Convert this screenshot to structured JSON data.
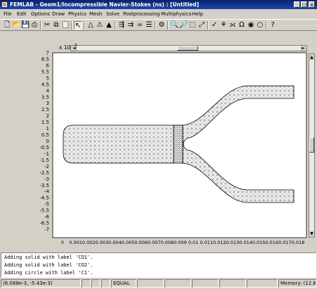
{
  "window": {
    "title": "FEMLAB - Geom1/Incompressible Navier-Stokes (ns) : [Untitled]",
    "min": "_",
    "max": "□",
    "close": "×"
  },
  "menu": [
    "File",
    "Edit",
    "Options",
    "Draw",
    "Physics",
    "Mesh",
    "Solve",
    "Postprocessing",
    "Multiphysics",
    "Help"
  ],
  "toolbar": [
    {
      "name": "new-icon",
      "glyph": "🗋"
    },
    {
      "name": "open-icon",
      "glyph": "📂"
    },
    {
      "name": "save-icon",
      "glyph": "💾"
    },
    {
      "name": "print-icon",
      "glyph": "⎙"
    },
    {
      "name": "cut-icon",
      "glyph": "✂"
    },
    {
      "name": "copy-icon",
      "glyph": "⧉"
    },
    {
      "name": "paste-icon",
      "glyph": "📋"
    },
    {
      "name": "pointer-icon",
      "glyph": "↖"
    },
    {
      "name": "triangle-icon",
      "glyph": "△"
    },
    {
      "name": "tri-refine-icon",
      "glyph": "⚠"
    },
    {
      "name": "mesh-icon",
      "glyph": "▲"
    },
    {
      "name": "boundary-icon",
      "glyph": "⇶"
    },
    {
      "name": "constraint-icon",
      "glyph": "⇉"
    },
    {
      "name": "equal-icon",
      "glyph": "="
    },
    {
      "name": "subdomain-icon",
      "glyph": "☰"
    },
    {
      "name": "solve-icon",
      "glyph": "⚙"
    },
    {
      "name": "zoom-in-icon",
      "glyph": "🔍"
    },
    {
      "name": "zoom-out-icon",
      "glyph": "🔎"
    },
    {
      "name": "zoom-box-icon",
      "glyph": "⬚"
    },
    {
      "name": "zoom-extents-icon",
      "glyph": "⤢"
    },
    {
      "name": "check-icon",
      "glyph": "✓"
    },
    {
      "name": "plot-icon",
      "glyph": "⚘"
    },
    {
      "name": "ruler-icon",
      "glyph": "⟗"
    },
    {
      "name": "omega-icon",
      "glyph": "Ω"
    },
    {
      "name": "sphere-icon",
      "glyph": "◉"
    },
    {
      "name": "circle-icon",
      "glyph": "○"
    },
    {
      "name": "help-icon",
      "glyph": "?"
    }
  ],
  "plot": {
    "y_multiplier": "x 10",
    "y_exponent": "-3",
    "y_ticks": [
      "7",
      "6.5",
      "6",
      "5.5",
      "5",
      "4.5",
      "4",
      "3.5",
      "3",
      "2.5",
      "2",
      "1.5",
      "1",
      "0.5",
      "0",
      "-0.5",
      "-1",
      "-1.5",
      "-2",
      "-2.5",
      "-3",
      "-3.5",
      "-4",
      "-4.5",
      "-5",
      "-5.5",
      "-6",
      "-6.5",
      "-7"
    ],
    "x_ticks": [
      "0",
      "0.001",
      "0.002",
      "0.003",
      "0.004",
      "0.005",
      "0.006",
      "0.007",
      "0.008",
      "0.009",
      "0.01",
      "0.011",
      "0.012",
      "0.013",
      "0.014",
      "0.015",
      "0.016",
      "0.017",
      "0.018"
    ]
  },
  "log": [
    "Adding solid with label 'CO1'.",
    "Adding solid with label 'CO2'.",
    "Adding circle with label 'C1'."
  ],
  "status": {
    "coords": "(6.088e-3, -5.43e-3)",
    "equal": "EQUAL",
    "memory": "Memory: (12.8 / 1"
  }
}
